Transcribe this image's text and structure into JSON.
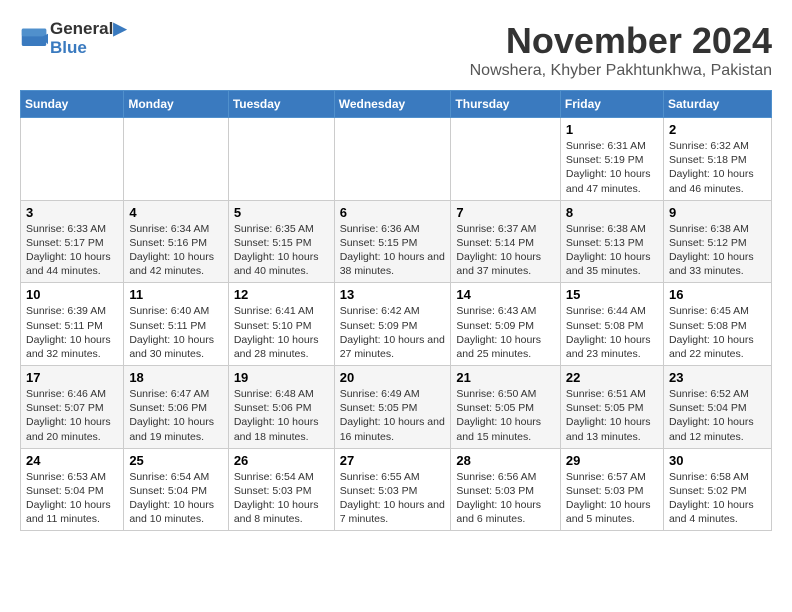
{
  "logo": {
    "line1": "General",
    "line2": "Blue"
  },
  "title": "November 2024",
  "location": "Nowshera, Khyber Pakhtunkhwa, Pakistan",
  "days_of_week": [
    "Sunday",
    "Monday",
    "Tuesday",
    "Wednesday",
    "Thursday",
    "Friday",
    "Saturday"
  ],
  "weeks": [
    [
      {
        "day": "",
        "info": ""
      },
      {
        "day": "",
        "info": ""
      },
      {
        "day": "",
        "info": ""
      },
      {
        "day": "",
        "info": ""
      },
      {
        "day": "",
        "info": ""
      },
      {
        "day": "1",
        "info": "Sunrise: 6:31 AM\nSunset: 5:19 PM\nDaylight: 10 hours and 47 minutes."
      },
      {
        "day": "2",
        "info": "Sunrise: 6:32 AM\nSunset: 5:18 PM\nDaylight: 10 hours and 46 minutes."
      }
    ],
    [
      {
        "day": "3",
        "info": "Sunrise: 6:33 AM\nSunset: 5:17 PM\nDaylight: 10 hours and 44 minutes."
      },
      {
        "day": "4",
        "info": "Sunrise: 6:34 AM\nSunset: 5:16 PM\nDaylight: 10 hours and 42 minutes."
      },
      {
        "day": "5",
        "info": "Sunrise: 6:35 AM\nSunset: 5:15 PM\nDaylight: 10 hours and 40 minutes."
      },
      {
        "day": "6",
        "info": "Sunrise: 6:36 AM\nSunset: 5:15 PM\nDaylight: 10 hours and 38 minutes."
      },
      {
        "day": "7",
        "info": "Sunrise: 6:37 AM\nSunset: 5:14 PM\nDaylight: 10 hours and 37 minutes."
      },
      {
        "day": "8",
        "info": "Sunrise: 6:38 AM\nSunset: 5:13 PM\nDaylight: 10 hours and 35 minutes."
      },
      {
        "day": "9",
        "info": "Sunrise: 6:38 AM\nSunset: 5:12 PM\nDaylight: 10 hours and 33 minutes."
      }
    ],
    [
      {
        "day": "10",
        "info": "Sunrise: 6:39 AM\nSunset: 5:11 PM\nDaylight: 10 hours and 32 minutes."
      },
      {
        "day": "11",
        "info": "Sunrise: 6:40 AM\nSunset: 5:11 PM\nDaylight: 10 hours and 30 minutes."
      },
      {
        "day": "12",
        "info": "Sunrise: 6:41 AM\nSunset: 5:10 PM\nDaylight: 10 hours and 28 minutes."
      },
      {
        "day": "13",
        "info": "Sunrise: 6:42 AM\nSunset: 5:09 PM\nDaylight: 10 hours and 27 minutes."
      },
      {
        "day": "14",
        "info": "Sunrise: 6:43 AM\nSunset: 5:09 PM\nDaylight: 10 hours and 25 minutes."
      },
      {
        "day": "15",
        "info": "Sunrise: 6:44 AM\nSunset: 5:08 PM\nDaylight: 10 hours and 23 minutes."
      },
      {
        "day": "16",
        "info": "Sunrise: 6:45 AM\nSunset: 5:08 PM\nDaylight: 10 hours and 22 minutes."
      }
    ],
    [
      {
        "day": "17",
        "info": "Sunrise: 6:46 AM\nSunset: 5:07 PM\nDaylight: 10 hours and 20 minutes."
      },
      {
        "day": "18",
        "info": "Sunrise: 6:47 AM\nSunset: 5:06 PM\nDaylight: 10 hours and 19 minutes."
      },
      {
        "day": "19",
        "info": "Sunrise: 6:48 AM\nSunset: 5:06 PM\nDaylight: 10 hours and 18 minutes."
      },
      {
        "day": "20",
        "info": "Sunrise: 6:49 AM\nSunset: 5:05 PM\nDaylight: 10 hours and 16 minutes."
      },
      {
        "day": "21",
        "info": "Sunrise: 6:50 AM\nSunset: 5:05 PM\nDaylight: 10 hours and 15 minutes."
      },
      {
        "day": "22",
        "info": "Sunrise: 6:51 AM\nSunset: 5:05 PM\nDaylight: 10 hours and 13 minutes."
      },
      {
        "day": "23",
        "info": "Sunrise: 6:52 AM\nSunset: 5:04 PM\nDaylight: 10 hours and 12 minutes."
      }
    ],
    [
      {
        "day": "24",
        "info": "Sunrise: 6:53 AM\nSunset: 5:04 PM\nDaylight: 10 hours and 11 minutes."
      },
      {
        "day": "25",
        "info": "Sunrise: 6:54 AM\nSunset: 5:04 PM\nDaylight: 10 hours and 10 minutes."
      },
      {
        "day": "26",
        "info": "Sunrise: 6:54 AM\nSunset: 5:03 PM\nDaylight: 10 hours and 8 minutes."
      },
      {
        "day": "27",
        "info": "Sunrise: 6:55 AM\nSunset: 5:03 PM\nDaylight: 10 hours and 7 minutes."
      },
      {
        "day": "28",
        "info": "Sunrise: 6:56 AM\nSunset: 5:03 PM\nDaylight: 10 hours and 6 minutes."
      },
      {
        "day": "29",
        "info": "Sunrise: 6:57 AM\nSunset: 5:03 PM\nDaylight: 10 hours and 5 minutes."
      },
      {
        "day": "30",
        "info": "Sunrise: 6:58 AM\nSunset: 5:02 PM\nDaylight: 10 hours and 4 minutes."
      }
    ]
  ]
}
